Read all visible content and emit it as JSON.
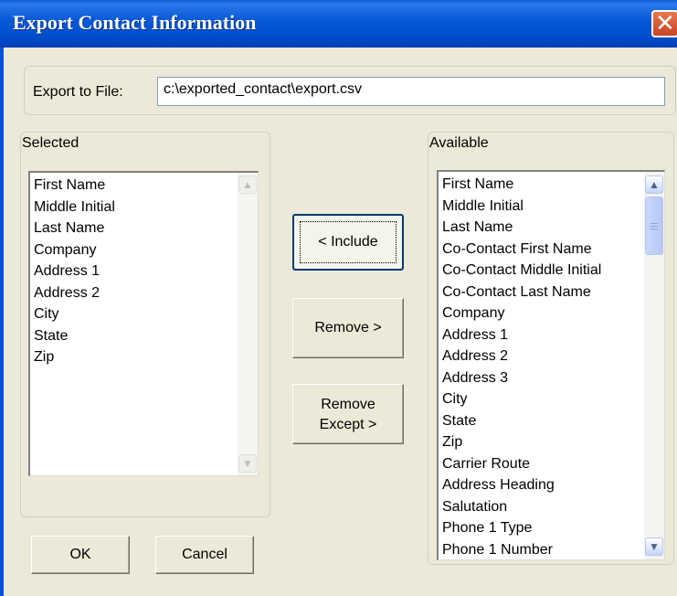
{
  "window": {
    "title": "Export Contact Information",
    "close_glyph": "✕"
  },
  "export": {
    "label": "Export to File:",
    "value": "c:\\exported_contact\\export.csv"
  },
  "selected": {
    "label": "Selected",
    "items": [
      "First Name",
      "Middle Initial",
      "Last Name",
      "Company",
      "Address 1",
      "Address 2",
      "City",
      "State",
      "Zip"
    ]
  },
  "available": {
    "label": "Available",
    "items": [
      "First Name",
      "Middle Initial",
      "Last Name",
      "Co-Contact First Name",
      "Co-Contact Middle Initial",
      "Co-Contact Last Name",
      "Company",
      "Address 1",
      "Address 2",
      "Address 3",
      "City",
      "State",
      "Zip",
      "Carrier Route",
      "Address Heading",
      "Salutation",
      "Phone 1 Type",
      "Phone 1 Number"
    ]
  },
  "buttons": {
    "include": "< Include",
    "remove": "Remove >",
    "remove_except_line1": "Remove",
    "remove_except_line2": "Except >",
    "ok": "OK",
    "cancel": "Cancel"
  },
  "icons": {
    "close": "close-icon",
    "scroll_up": "chevron-up-icon",
    "scroll_down": "chevron-down-icon"
  },
  "colors": {
    "titlebar": "#0054e3",
    "dialog_bg": "#ece9d8",
    "close_red": "#d9542a"
  }
}
